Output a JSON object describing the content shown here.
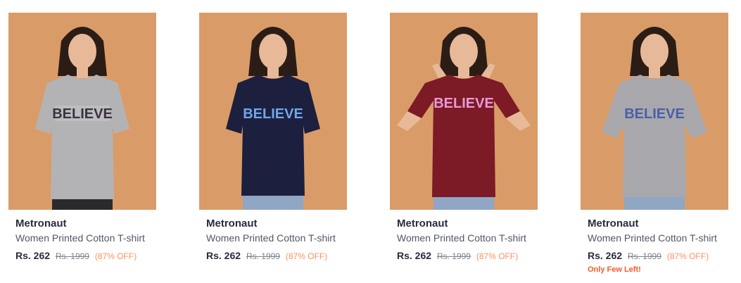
{
  "products": [
    {
      "brand": "Metronaut",
      "title": "Women Printed Cotton T-shirt",
      "price": "Rs. 262",
      "mrp": "Rs. 1999",
      "discount": "(87% OFF)",
      "stock_note": "",
      "shirt_color": "#b3b3b6",
      "print_text": "BELIEVE"
    },
    {
      "brand": "Metronaut",
      "title": "Women Printed Cotton T-shirt",
      "price": "Rs. 262",
      "mrp": "Rs. 1999",
      "discount": "(87% OFF)",
      "stock_note": "",
      "shirt_color": "#1d1f3f",
      "print_text": "BELIEVE"
    },
    {
      "brand": "Metronaut",
      "title": "Women Printed Cotton T-shirt",
      "price": "Rs. 262",
      "mrp": "Rs. 1999",
      "discount": "(87% OFF)",
      "stock_note": "",
      "shirt_color": "#7c1a25",
      "print_text": "BELIEVE"
    },
    {
      "brand": "Metronaut",
      "title": "Women Printed Cotton T-shirt",
      "price": "Rs. 262",
      "mrp": "Rs. 1999",
      "discount": "(87% OFF)",
      "stock_note": "Only Few Left!",
      "shirt_color": "#a8a8ac",
      "print_text": "BELIEVE"
    }
  ],
  "colors": {
    "background_tile": "#d99c68",
    "brand_text": "#282c3f",
    "discount": "#ff905a",
    "stock_warning": "#ff5722"
  }
}
